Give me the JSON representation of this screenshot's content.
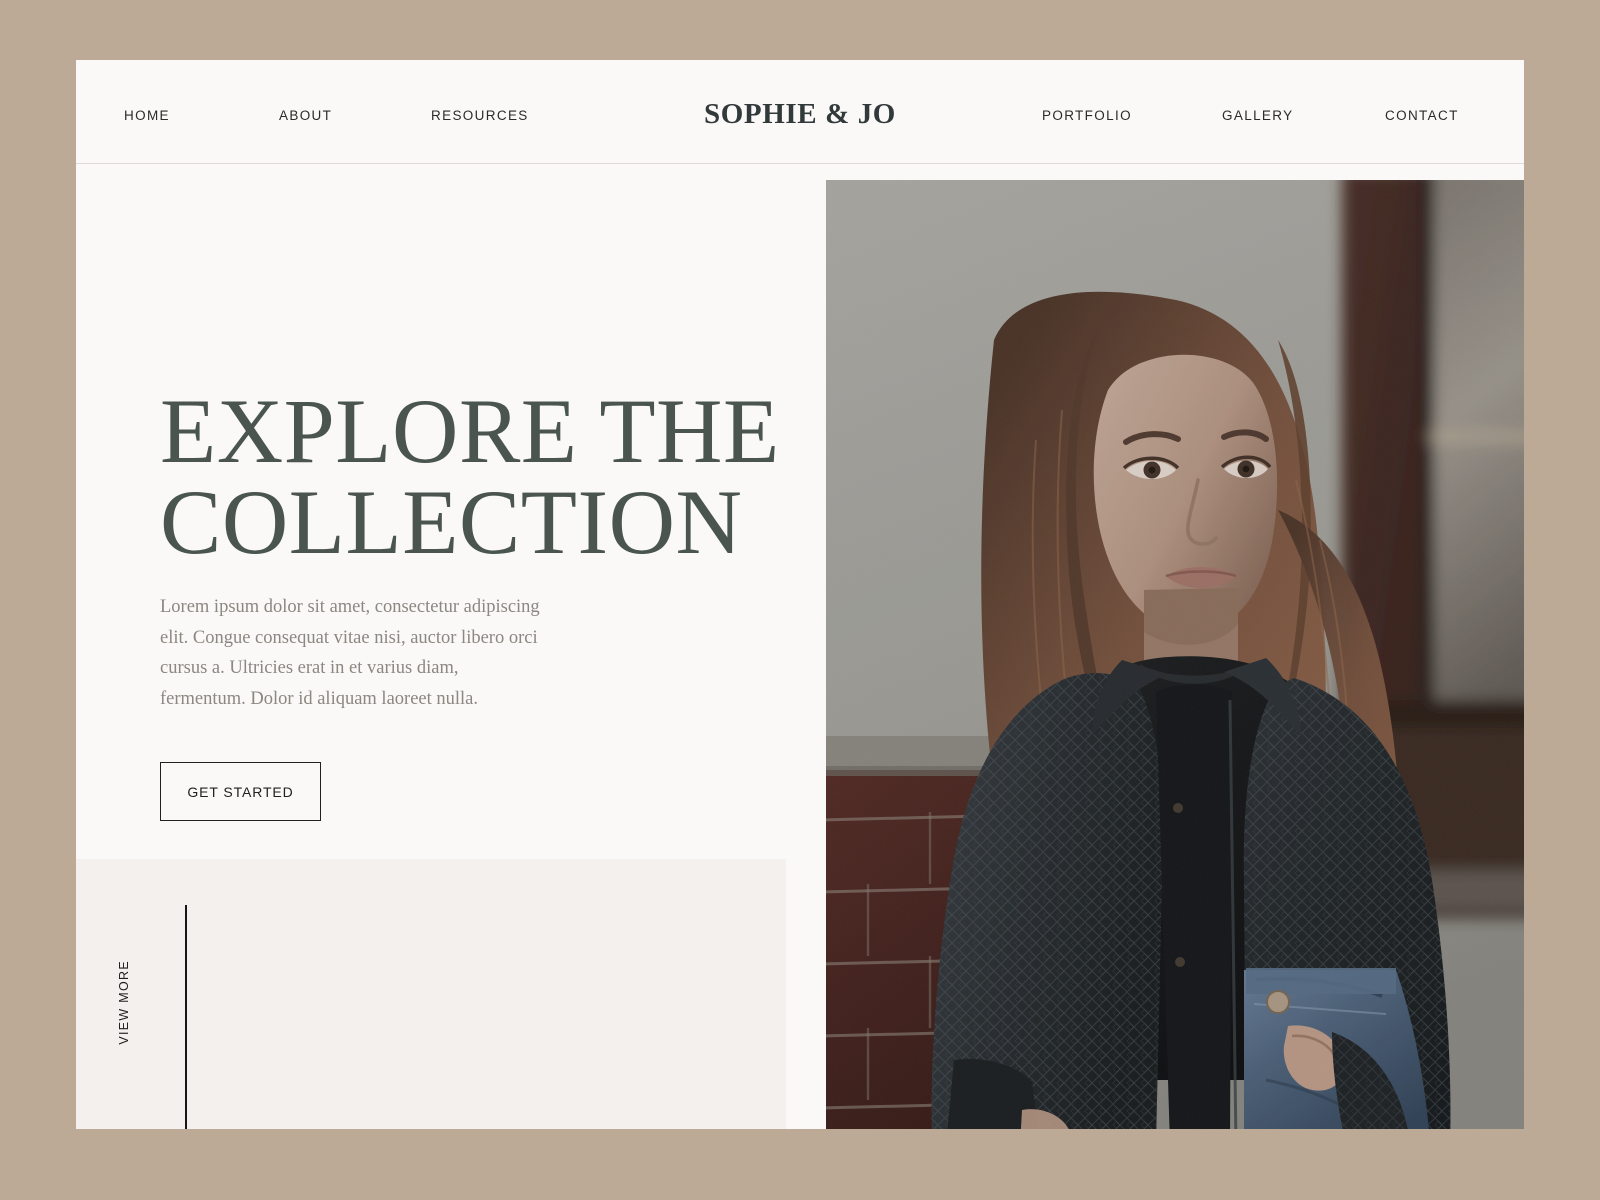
{
  "theme": {
    "page_background": "#bca996",
    "card_background": "#faf9f7",
    "lower_panel_background": "#f4f0ed",
    "headline_color": "#4a5550",
    "body_text_color": "#8b8781",
    "nav_text_color": "#2b2b2b",
    "brand_color": "#32393a",
    "rule_color": "#161616"
  },
  "nav": {
    "brand": "SOPHIE & JO",
    "left_items": [
      {
        "label": "HOME"
      },
      {
        "label": "ABOUT"
      },
      {
        "label": "RESOURCES"
      }
    ],
    "right_items": [
      {
        "label": "PORTFOLIO"
      },
      {
        "label": "GALLERY"
      },
      {
        "label": "CONTACT"
      }
    ]
  },
  "hero": {
    "headline": "EXPLORE THE\nCOLLECTION",
    "headline_line1": "EXPLORE THE",
    "headline_line2": "COLLECTION",
    "paragraph": "Lorem ipsum dolor sit amet, consectetur adipiscing elit. Congue consequat vitae nisi, auctor libero orci cursus a. Ultricies erat in et varius diam, fermentum. Dolor id aliquam laoreet nulla.",
    "cta_label": "GET STARTED"
  },
  "footer_strip": {
    "view_more_label": "VIEW MORE"
  },
  "photo": {
    "alt": "Woman in dark snakeskin-print jacket and blue jeans standing against a grey wall with red brick and a dark doorway",
    "wall_color": "#a8a7a2",
    "hair_color": "#6b4a3a",
    "jacket_color": "#22262a",
    "denim_color": "#4c6480",
    "brick_color": "#4a2320",
    "door_color": "#3a2420"
  }
}
